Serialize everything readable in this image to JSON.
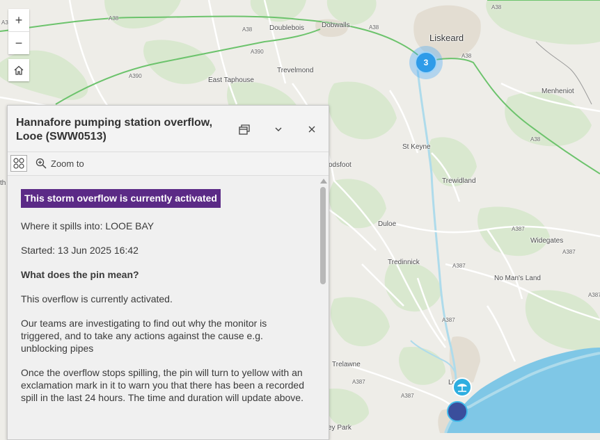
{
  "map": {
    "places": [
      {
        "name": "Liskeard",
        "cls": "town"
      },
      {
        "name": "Dobwalls",
        "cls": ""
      },
      {
        "name": "Doublebois",
        "cls": ""
      },
      {
        "name": "East Taphouse",
        "cls": ""
      },
      {
        "name": "Trevelmond",
        "cls": ""
      },
      {
        "name": "Menheniot",
        "cls": ""
      },
      {
        "name": "St Keyne",
        "cls": ""
      },
      {
        "name": "Trewidland",
        "cls": ""
      },
      {
        "name": "Duloe",
        "cls": ""
      },
      {
        "name": "Widegates",
        "cls": ""
      },
      {
        "name": "Tredinnick",
        "cls": ""
      },
      {
        "name": "No Man's Land",
        "cls": ""
      },
      {
        "name": "Trelawne",
        "cls": ""
      },
      {
        "name": "odsfoot",
        "cls": ""
      },
      {
        "name": "ey Park",
        "cls": ""
      },
      {
        "name": "Lo",
        "cls": ""
      },
      {
        "name": "th",
        "cls": ""
      }
    ],
    "road_labels": [
      "A38",
      "A38",
      "A38",
      "A38",
      "A38",
      "A38",
      "A390",
      "A390",
      "A390",
      "A387",
      "A387",
      "A387",
      "A387",
      "A387",
      "A387",
      "A387"
    ],
    "cluster_count": "3",
    "colors": {
      "water": "#aedbeb",
      "sea": "#7fc7e6",
      "woodland": "#d9e8cf",
      "urban": "#e3ddd2",
      "road_major": "#6cc36c",
      "road_minor": "#ffffff"
    }
  },
  "controls": {
    "zoom_in": "+",
    "zoom_out": "−",
    "home_icon": "home-icon"
  },
  "popup": {
    "title": "Hannafore pumping station overflow, Looe (SWW0513)",
    "zoom_to_label": "Zoom to",
    "status_badge": "This storm overflow is currently activated",
    "spills_into": "Where it spills into: LOOE BAY",
    "started": "Started: 13 Jun 2025 16:42",
    "pin_heading": "What does the pin mean?",
    "pin_meaning": "This overflow is currently activated.",
    "investigating": "Our teams are investigating to find out why the monitor is triggered, and to take any actions against the cause e.g. unblocking pipes",
    "once_stops": "Once the overflow stops spilling, the pin will turn to yellow with an exclamation mark in it to warn you that there has been a recorded spill in the last 24 hours. The time and duration will update above.",
    "colors": {
      "badge": "#5b2a86"
    }
  }
}
